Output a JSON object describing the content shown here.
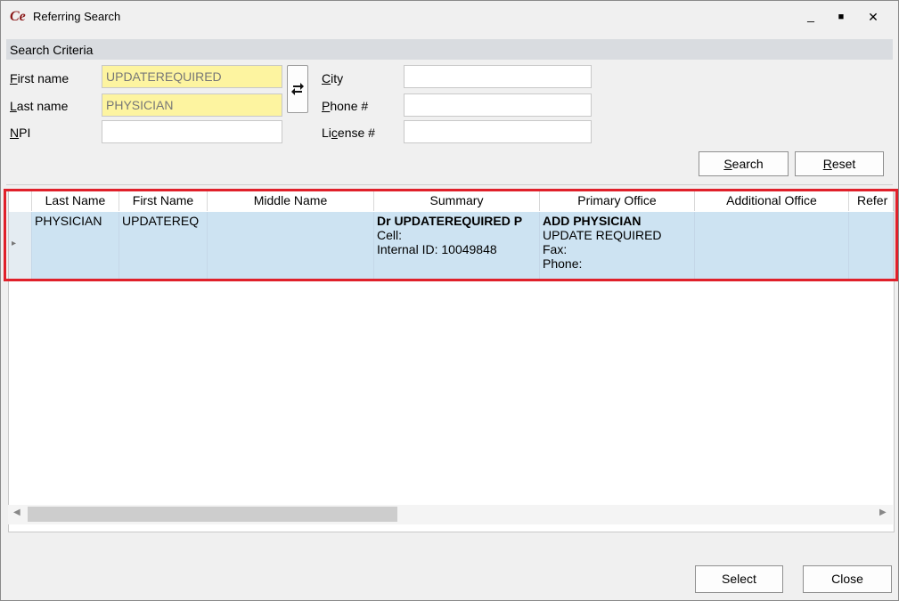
{
  "window": {
    "title": "Referring Search",
    "logo_text": "Ce",
    "minimize_glyph": "_",
    "maximize_glyph": "■",
    "close_glyph": "✕"
  },
  "search_criteria": {
    "header": "Search Criteria",
    "first_name": {
      "label_accel": "F",
      "label_rest": "irst name",
      "value": "UPDATEREQUIRED"
    },
    "last_name": {
      "label_accel": "L",
      "label_rest": "ast name",
      "value": "PHYSICIAN"
    },
    "npi": {
      "label_accel": "N",
      "label_rest": "PI",
      "value": ""
    },
    "city": {
      "label_accel": "C",
      "label_rest": "ity",
      "value": ""
    },
    "phone": {
      "label_accel": "P",
      "label_rest": "hone #",
      "value": ""
    },
    "license": {
      "label_pre": "Li",
      "label_accel": "c",
      "label_rest": "ense #",
      "value": ""
    },
    "swap_icon": "swap-arrows",
    "search_button": {
      "accel": "S",
      "rest": "earch"
    },
    "reset_button": {
      "accel": "R",
      "rest": "eset"
    }
  },
  "results": {
    "columns": [
      "Last Name",
      "First Name",
      "Middle Name",
      "Summary",
      "Primary Office",
      "Additional Office",
      "Refer"
    ],
    "rows": [
      {
        "last_name": "PHYSICIAN",
        "first_name": "UPDATEREQ",
        "middle_name": "",
        "summary_line1": "Dr UPDATEREQUIRED P",
        "summary_line2": "Cell:",
        "summary_line3": "Internal ID: 10049848",
        "primary_line1": "ADD PHYSICIAN",
        "primary_line2": "UPDATE REQUIRED",
        "primary_line3": "Fax:",
        "primary_line4": "Phone:",
        "additional_office": ""
      }
    ],
    "row_indicator": "▸"
  },
  "footer": {
    "select_label": "Select",
    "close_label": "Close"
  },
  "colors": {
    "highlight_field": "#fdf4a0",
    "selected_row": "#cde3f2",
    "annotation_box": "#e0202a"
  }
}
